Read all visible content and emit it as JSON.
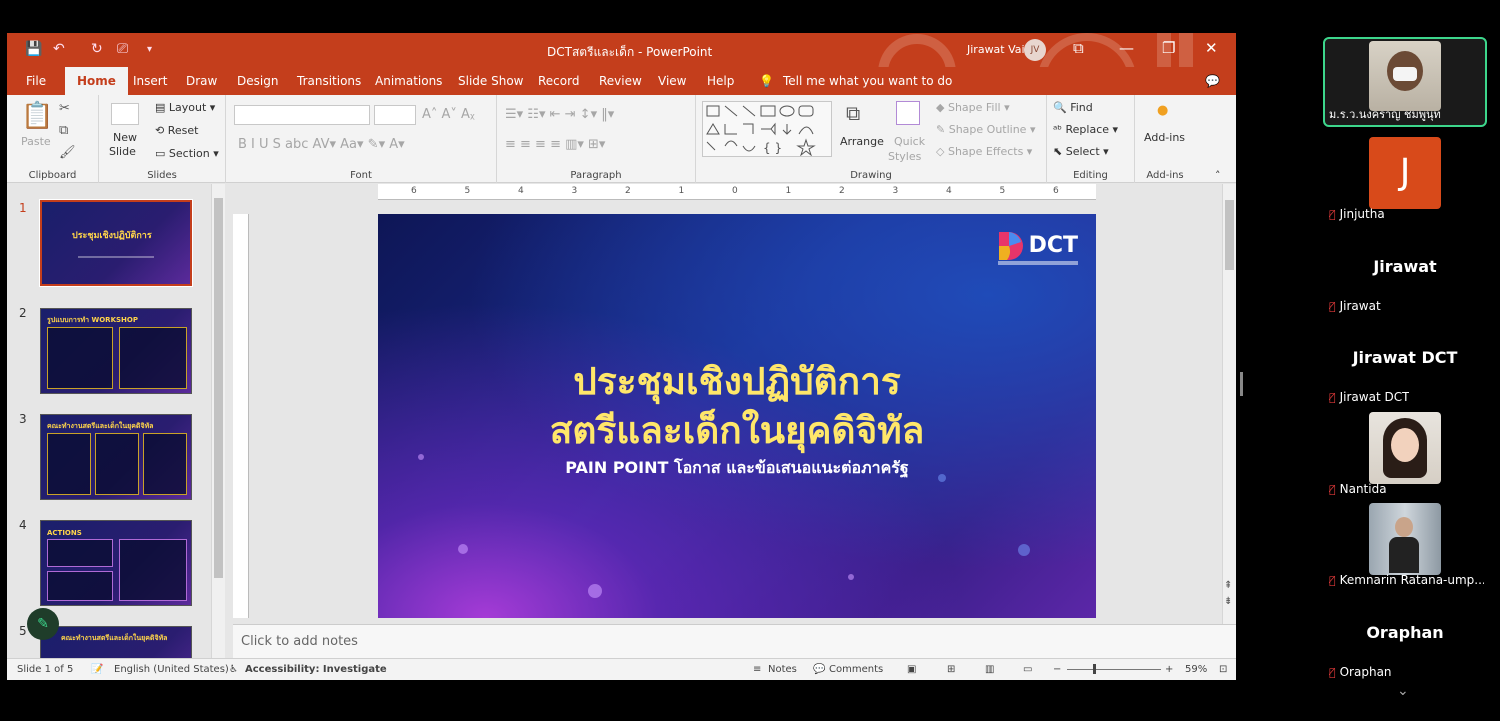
{
  "window": {
    "doc_title": "DCTสตรีและเด็ก - PowerPoint",
    "user_name": "Jirawat Vai",
    "user_initials": "JV"
  },
  "tabs": [
    "File",
    "Home",
    "Insert",
    "Draw",
    "Design",
    "Transitions",
    "Animations",
    "Slide Show",
    "Record",
    "Review",
    "View",
    "Help"
  ],
  "tell_me": "Tell me what you want to do",
  "ribbon": {
    "clipboard": {
      "paste": "Paste",
      "label": "Clipboard"
    },
    "slides": {
      "new_slide": "New",
      "new_slide2": "Slide",
      "layout": "Layout",
      "reset": "Reset",
      "section": "Section",
      "label": "Slides"
    },
    "font": {
      "label": "Font"
    },
    "paragraph": {
      "label": "Paragraph"
    },
    "drawing": {
      "arrange": "Arrange",
      "quick_styles": "Quick",
      "quick_styles2": "Styles",
      "shape_fill": "Shape Fill",
      "shape_outline": "Shape Outline",
      "shape_effects": "Shape Effects",
      "label": "Drawing"
    },
    "editing": {
      "find": "Find",
      "replace": "Replace",
      "select": "Select",
      "label": "Editing"
    },
    "addins": {
      "addins": "Add-ins",
      "label": "Add-ins"
    }
  },
  "thumbnails": [
    {
      "num": "1",
      "title": "ประชุมเชิงปฏิบัติการ"
    },
    {
      "num": "2",
      "title": "รูปแบบการทำ WORKSHOP"
    },
    {
      "num": "3",
      "title": "คณะทำงานสตรีและเด็กในยุคดิจิทัล"
    },
    {
      "num": "4",
      "title": "ACTIONS"
    },
    {
      "num": "5",
      "title": "คณะทำงานสตรีและเด็กในยุคดิจิทัล"
    }
  ],
  "slide": {
    "logo": "DCT",
    "title_line1": "ประชุมเชิงปฏิบัติการ",
    "title_line2": "สตรีและเด็กในยุคดิจิทัล",
    "subtitle": "PAIN POINT โอกาส และข้อเสนอแนะต่อภาครัฐ"
  },
  "ruler": {
    "h_ticks": [
      "6",
      "5",
      "4",
      "3",
      "2",
      "1",
      "0",
      "1",
      "2",
      "3",
      "4",
      "5",
      "6"
    ]
  },
  "notes_placeholder": "Click to add notes",
  "status": {
    "slide_info": "Slide 1 of 5",
    "language": "English (United States)",
    "accessibility": "Accessibility: Investigate",
    "notes": "Notes",
    "comments": "Comments",
    "zoom": "59%"
  },
  "participants": [
    {
      "name": "ม.ร.ว.นงคราญ ชมพูนุท",
      "speaking": true,
      "type": "video"
    },
    {
      "name": "Jinjutha",
      "type": "initial",
      "initial": "J"
    },
    {
      "name": "Jirawat",
      "type": "name",
      "display": "Jirawat"
    },
    {
      "name": "Jirawat DCT",
      "type": "name",
      "display": "Jirawat DCT"
    },
    {
      "name": "Nantida",
      "type": "photo"
    },
    {
      "name": "Kemnarin Ratana-ump...",
      "type": "photo"
    },
    {
      "name": "Oraphan",
      "type": "name",
      "display": "Oraphan"
    }
  ],
  "colors": {
    "accent": "#c43e1c",
    "slide_title": "#ffe76a",
    "speaking_border": "#3dd68c"
  }
}
